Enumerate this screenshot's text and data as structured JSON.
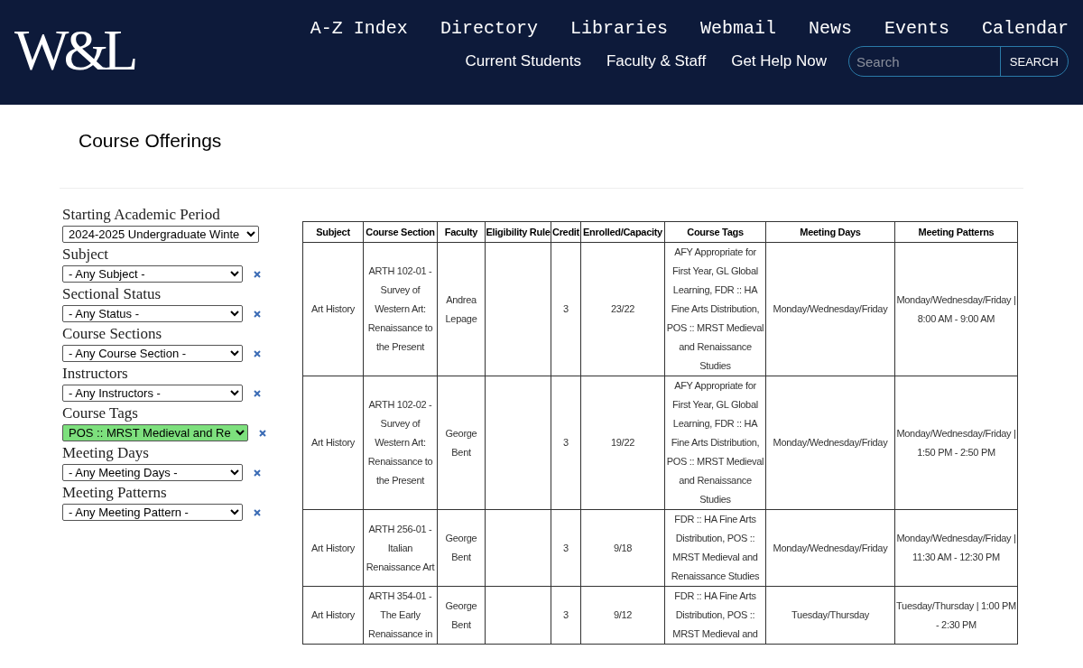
{
  "header": {
    "logo": "W&L",
    "top_links": [
      "A-Z Index",
      "Directory",
      "Libraries",
      "Webmail",
      "News",
      "Events",
      "Calendar"
    ],
    "sub_links": [
      "Current Students",
      "Faculty & Staff",
      "Get Help Now"
    ],
    "search": {
      "placeholder": "Search",
      "button": "SEARCH"
    }
  },
  "page_title": "Course Offerings",
  "filters": [
    {
      "label": "Starting Academic Period",
      "value": "2024-2025 Undergraduate Winte",
      "clearable": false,
      "highlighted": false
    },
    {
      "label": "Subject",
      "value": "- Any Subject -",
      "clearable": true,
      "highlighted": false
    },
    {
      "label": "Sectional Status",
      "value": "- Any Status -",
      "clearable": true,
      "highlighted": false
    },
    {
      "label": "Course Sections",
      "value": "- Any Course Section -",
      "clearable": true,
      "highlighted": false
    },
    {
      "label": "Instructors",
      "value": "- Any Instructors -",
      "clearable": true,
      "highlighted": false
    },
    {
      "label": "Course Tags",
      "value": "POS :: MRST Medieval and Re",
      "clearable": true,
      "highlighted": true
    },
    {
      "label": "Meeting Days",
      "value": "- Any Meeting Days -",
      "clearable": true,
      "highlighted": false
    },
    {
      "label": "Meeting Patterns",
      "value": "- Any Meeting Pattern -",
      "clearable": true,
      "highlighted": false
    }
  ],
  "table": {
    "columns": [
      "Subject",
      "Course Section",
      "Faculty",
      "Eligibility Rule",
      "Credit",
      "Enrolled/Capacity",
      "Course Tags",
      "Meeting Days",
      "Meeting Patterns"
    ],
    "rows": [
      [
        "Art History",
        "ARTH 102-01 - Survey of Western Art: Renaissance to the Present",
        "Andrea Lepage",
        "",
        "3",
        "23/22",
        "AFY Appropriate for First Year, GL Global Learning, FDR :: HA Fine Arts Distribution, POS :: MRST Medieval and Renaissance Studies",
        "Monday/Wednesday/Friday",
        "Monday/Wednesday/Friday | 8:00 AM - 9:00 AM"
      ],
      [
        "Art History",
        "ARTH 102-02 - Survey of Western Art: Renaissance to the Present",
        "George Bent",
        "",
        "3",
        "19/22",
        "AFY Appropriate for First Year, GL Global Learning, FDR :: HA Fine Arts Distribution, POS :: MRST Medieval and Renaissance Studies",
        "Monday/Wednesday/Friday",
        "Monday/Wednesday/Friday | 1:50 PM - 2:50 PM"
      ],
      [
        "Art History",
        "ARTH 256-01 - Italian Renaissance Art",
        "George Bent",
        "",
        "3",
        "9/18",
        "FDR :: HA Fine Arts Distribution, POS :: MRST Medieval and Renaissance Studies",
        "Monday/Wednesday/Friday",
        "Monday/Wednesday/Friday | 11:30 AM - 12:30 PM"
      ],
      [
        "Art History",
        "ARTH 354-01 - The Early Renaissance in",
        "George Bent",
        "",
        "3",
        "9/12",
        "FDR :: HA Fine Arts Distribution, POS :: MRST Medieval and",
        "Tuesday/Thursday",
        "Tuesday/Thursday | 1:00 PM - 2:30 PM"
      ]
    ]
  }
}
